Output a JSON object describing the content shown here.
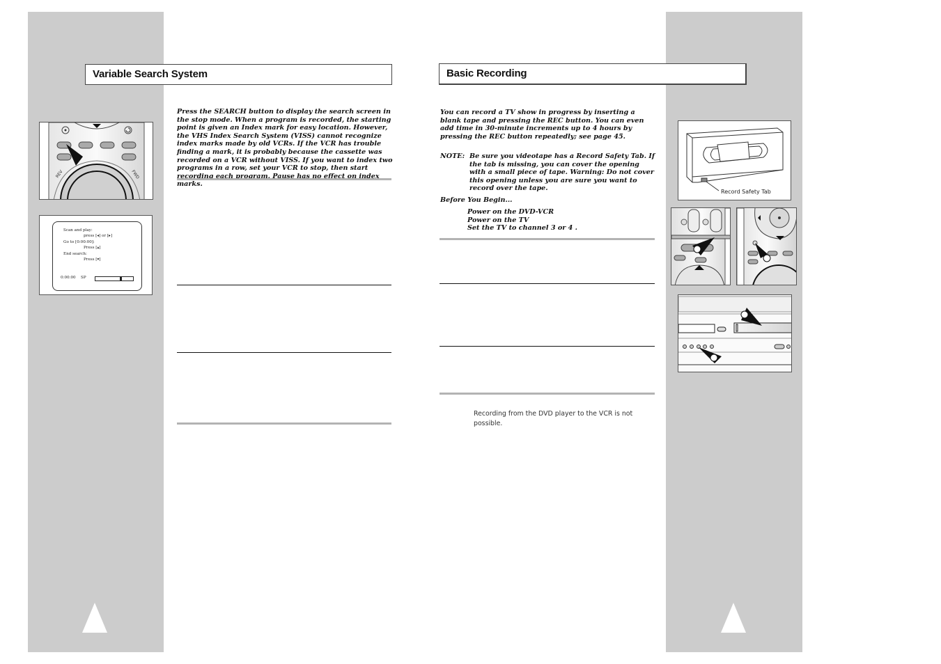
{
  "left_page": {
    "title": "Variable Search System",
    "intro": "Press the SEARCH button to display the search screen in the stop mode. When a program is recorded, the starting point is given an Index mark for easy location. However, the VHS Index Search System (VISS) cannot recognize index marks made by old VCRs. If the VCR has trouble finding a mark, it is probably because the cassette was recorded on a VCR without VISS. If you want to index two programs in a row, set your VCR to stop, then start recording each program. Pause has no effect on index marks.",
    "remote_labels": {
      "rev": "REV",
      "fwd": "FWD"
    },
    "osd": {
      "scan_label": "Scan and play:",
      "scan_action": "press [◂] or [▸]",
      "goto_label": "Go to [0:00:00]:",
      "goto_action": "Press [▴]",
      "end_label": "End search:",
      "end_action": "Press [▾]",
      "counter": "0:00:00",
      "speed": "SP",
      "position_fraction": 0.68
    }
  },
  "right_page": {
    "title": "Basic Recording",
    "intro": "You can record a TV show in progress by inserting a blank tape and pressing the REC button. You can even add time in 30-minute increments up to 4 hours by pressing the REC button repeatedly; see page 45.",
    "note_label": "NOTE:",
    "note_body": "Be sure you videotape has a Record Safety Tab. If the tab is missing, you can cover the opening with a small piece of tape. Warning: Do not cover this opening unless you are sure you want to record over the tape.",
    "before_heading": "Before You Begin...",
    "before_items": [
      "Power on the DVD-VCR",
      "Power on the TV",
      "Set the TV to channel 3 or 4 ."
    ],
    "dvd_note": "Recording from the DVD player to the VCR is not possible.",
    "cassette_label": "Record Safety Tab"
  }
}
